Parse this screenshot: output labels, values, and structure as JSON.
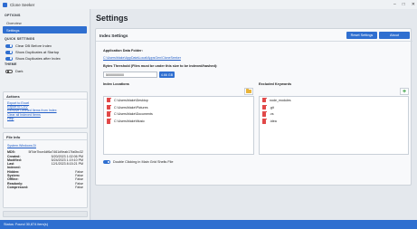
{
  "window": {
    "title": "Clone Seeker"
  },
  "sidebar": {
    "options_header": "OPTIONS",
    "nav": [
      {
        "label": "Overview",
        "active": false
      },
      {
        "label": "Settings",
        "active": true
      }
    ],
    "quick_settings_header": "QUICK SETTINGS",
    "quick_settings": [
      {
        "label": "Clear DB Before Index",
        "on": true
      },
      {
        "label": "Show Duplicates at Startup",
        "on": true
      },
      {
        "label": "Show Duplicates after Index",
        "on": true
      }
    ],
    "theme_header": "THEME",
    "theme": {
      "label": "Dark",
      "on": false
    }
  },
  "actions": {
    "title": "Actions",
    "links": [
      "Export to Excel",
      "Export to CSV",
      "Remove Deleted Items from Index",
      "Clear all Indexed Items",
      "Help"
    ]
  },
  "file_info": {
    "title": "File Info",
    "path": "System.Windows.Di",
    "rows": [
      {
        "key": "MD5:",
        "value": "5f7de7bce4df6a7461d9eab17fa0bc32"
      },
      {
        "key": "Created:",
        "value": "5/20/2023 1:02:06 PM"
      },
      {
        "key": "Modified:",
        "value": "5/24/2023 1:19:10 PM"
      },
      {
        "key": "Last Indexed:",
        "value": "12/1/2023 8:15:21 PM"
      },
      {
        "key": "Hidden:",
        "value": "False"
      },
      {
        "key": "System:",
        "value": "False"
      },
      {
        "key": "Offline:",
        "value": "False"
      },
      {
        "key": "Readonly:",
        "value": "False"
      },
      {
        "key": "Compressed:",
        "value": "False"
      }
    ]
  },
  "status": {
    "text": "Status: Found 30,874 item(s)"
  },
  "settings": {
    "page_title": "Settings",
    "card_title": "Index Settings",
    "reset_label": "Reset Settings",
    "about_label": "About",
    "app_data_label": "Application Data Folder:",
    "app_data_path": "C:\\Users\\blake\\AppData\\Local\\AppsGen\\CloneSeeker",
    "threshold_label": "Bytes Threshold (Files must be under this size to be indexed/hashed):",
    "threshold_value": "5000000000",
    "threshold_size": "4.66 GB",
    "index_locations_label": "Index Locations",
    "index_locations": [
      "C:\\Users\\blake\\Desktop",
      "C:\\Users\\blake\\Pictures",
      "C:\\Users\\blake\\Documents",
      "C:\\Users\\blake\\Music"
    ],
    "excluded_label": "Excluded Keywords",
    "excluded_keywords": [
      "node_modules",
      ".git",
      ".vs",
      ".idea"
    ],
    "double_click_label": "Double Clicking in Main Grid Shells File",
    "double_click_on": true
  },
  "colors": {
    "accent": "#2f6fd0",
    "delete": "#e14848",
    "folder": "#e8b33a",
    "add": "#2f9a3a"
  }
}
